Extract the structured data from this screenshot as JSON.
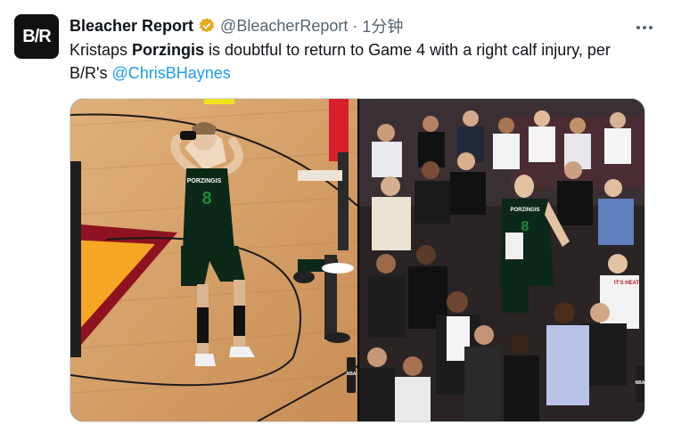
{
  "tweet": {
    "avatar_text": "B/R",
    "display_name": "Bleacher Report",
    "handle": "@BleacherReport",
    "separator": "·",
    "timestamp": "1分钟",
    "text_before": "Kristaps ",
    "text_bold": "Porzingis",
    "text_middle": " is doubtful to return to Game 4 with a right calf injury, per B/R's ",
    "mention": "@ChrisBHaynes"
  },
  "media": {
    "left_jersey_name": "PORZINGIS",
    "left_jersey_number": "8",
    "right_jersey_name": "PORZINGIS",
    "right_jersey_number": "8",
    "fan_shirt_text": "IT'S HEAT",
    "logo_text": "NBA"
  },
  "colors": {
    "verified": "#e8a817",
    "mention": "#1d9bf0",
    "jersey": "#0c2818",
    "jersey_number": "#1f8a3c",
    "court_wood": "#d9a56a",
    "court_red": "#8f1220",
    "court_yellow": "#f5a623"
  },
  "icons": {
    "verified": "verified-badge-icon",
    "more": "more-horizontal-icon"
  }
}
